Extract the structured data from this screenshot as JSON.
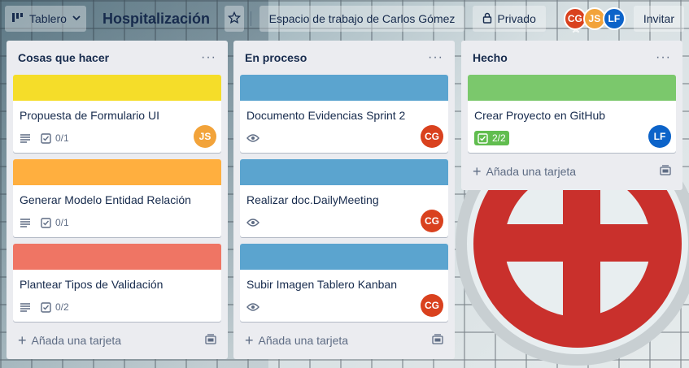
{
  "topbar": {
    "board_switch_label": "Tablero",
    "board_title": "Hospitalización",
    "workspace_label": "Espacio de trabajo de Carlos Gómez",
    "privacy_label": "Privado",
    "invite_label": "Invitar",
    "members": [
      {
        "initials": "CG",
        "color": "#d9411e"
      },
      {
        "initials": "JS",
        "color": "#f2a33a"
      },
      {
        "initials": "LF",
        "color": "#0c63c9"
      }
    ]
  },
  "colors": {
    "yellow": "#f5dd29",
    "orange": "#ffaf3f",
    "red": "#ef7564",
    "blue": "#5ba4cf",
    "green": "#7bc86c",
    "avatar_cg": "#d9411e",
    "avatar_js": "#f2a33a",
    "avatar_lf": "#0c63c9"
  },
  "lists": [
    {
      "title": "Cosas que hacer",
      "menu": "···",
      "add_label": "Añada una tarjeta",
      "cards": [
        {
          "title": "Propuesta de Formulario UI",
          "checklist": "0/1",
          "member": "JS"
        },
        {
          "title": "Generar Modelo Entidad Relación",
          "checklist": "0/1"
        },
        {
          "title": "Plantear Tipos de Validación",
          "checklist": "0/2"
        }
      ]
    },
    {
      "title": "En proceso",
      "menu": "···",
      "add_label": "Añada una tarjeta",
      "cards": [
        {
          "title": "Documento Evidencias Sprint 2",
          "member": "CG"
        },
        {
          "title": "Realizar doc.DailyMeeting",
          "member": "CG"
        },
        {
          "title": "Subir Imagen Tablero Kanban",
          "member": "CG"
        }
      ]
    },
    {
      "title": "Hecho",
      "menu": "···",
      "add_label": "Añada una tarjeta",
      "cards": [
        {
          "title": "Crear Proyecto en GitHub",
          "checklist": "2/2",
          "member": "LF"
        }
      ]
    }
  ]
}
